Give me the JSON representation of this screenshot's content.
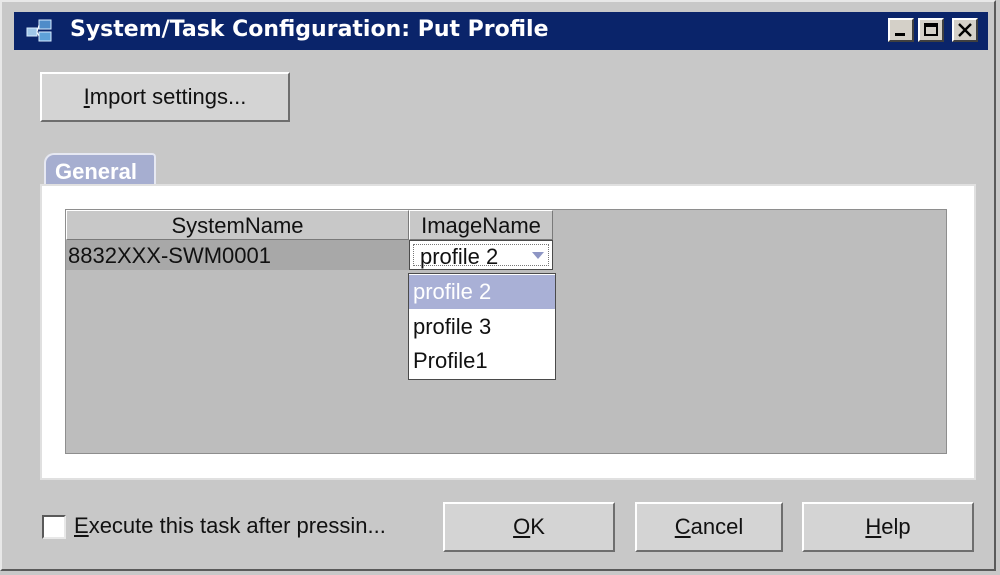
{
  "window": {
    "title": "System/Task Configuration: Put Profile",
    "controls": [
      "minimize-icon",
      "maximize-icon",
      "close-icon"
    ]
  },
  "import_button": {
    "mnemonic": "I",
    "rest": "mport settings..."
  },
  "tab": {
    "label": "General"
  },
  "table": {
    "columns": [
      "SystemName",
      "ImageName"
    ],
    "rows": [
      {
        "system_name": "8832XXX-SWM0001",
        "image_name": "profile 2"
      }
    ]
  },
  "dropdown": {
    "options": [
      "profile 2",
      "profile 3",
      "Profile1"
    ],
    "selected_index": 0
  },
  "footer": {
    "checkbox": {
      "mnemonic": "E",
      "rest": "xecute this task after pressin...",
      "checked": false
    },
    "ok": {
      "mnemonic": "O",
      "rest": "K"
    },
    "cancel": {
      "mnemonic": "C",
      "rest": "ancel"
    },
    "help": {
      "mnemonic": "H",
      "rest": "elp"
    }
  },
  "colors": {
    "titlebar": "#0a246a",
    "window_bg": "#c8c8c8",
    "tab": "#a6aed0",
    "selection": "#a9b0d6"
  }
}
